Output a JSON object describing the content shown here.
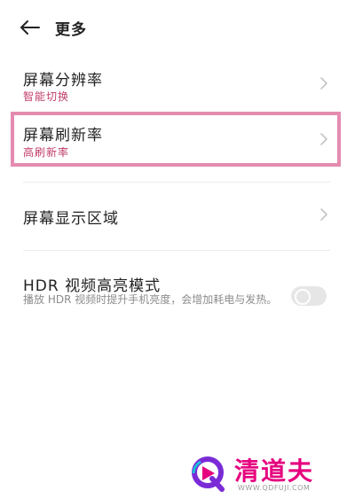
{
  "header": {
    "title": "更多",
    "back_icon": "arrow-left-icon"
  },
  "settings": {
    "resolution": {
      "title": "屏幕分辨率",
      "value": "智能切换"
    },
    "refresh_rate": {
      "title": "屏幕刷新率",
      "value": "高刷新率"
    },
    "display_area": {
      "title": "屏幕显示区域"
    },
    "hdr": {
      "title": "HDR 视频高亮模式",
      "description": "播放 HDR 视频时提升手机亮度，会增加耗电与发热。",
      "enabled": false
    }
  },
  "colors": {
    "accent": "#c03b6a",
    "highlight": "#e58bb0"
  },
  "watermark": {
    "name": "清道夫",
    "url": "WWW.QDFUJI.COM"
  }
}
